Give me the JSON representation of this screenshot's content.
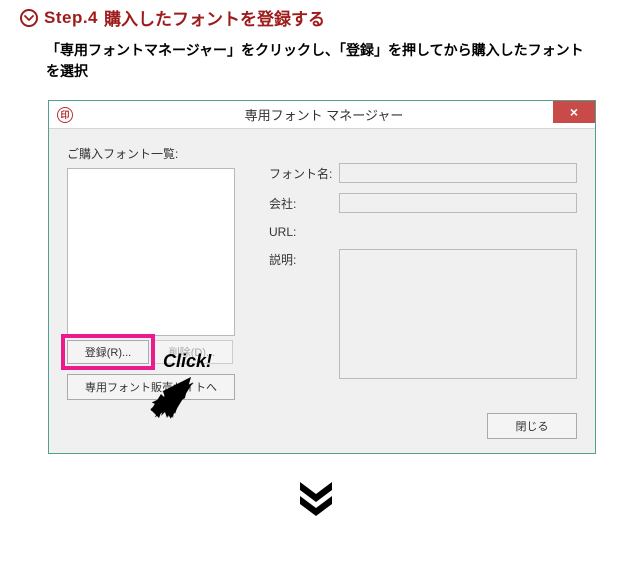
{
  "step": {
    "label": "Step.4",
    "title": "購入したフォントを登録する"
  },
  "instruction": "「専用フォントマネージャー」をクリックし、「登録」を押してから購入したフォントを選択",
  "window": {
    "title": "専用フォント マネージャー",
    "close_symbol": "×",
    "app_icon_label": "印"
  },
  "panel": {
    "list_label": "ご購入フォント一覧:",
    "register_btn": "登録(R)...",
    "delete_btn": "削除(D)...",
    "sales_btn": "専用フォント販売サイトへ"
  },
  "fields": {
    "font_name_label": "フォント名:",
    "font_name_value": "",
    "company_label": "会社:",
    "company_value": "",
    "url_label": "URL:",
    "url_value": "",
    "desc_label": "説明:",
    "desc_value": ""
  },
  "close_btn": "閉じる",
  "callout": "Click!"
}
